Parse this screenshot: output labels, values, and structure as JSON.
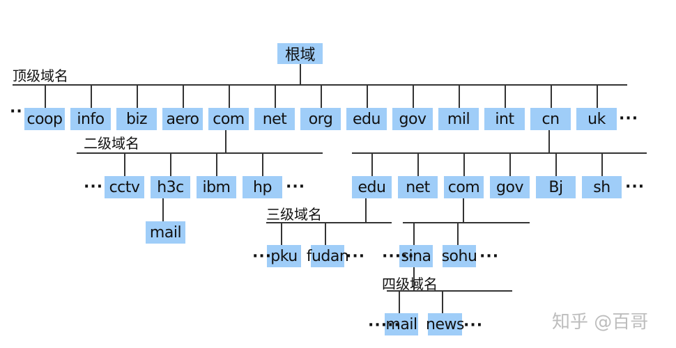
{
  "root": {
    "label": "根域"
  },
  "levels": {
    "top": "顶级域名",
    "second": "二级域名",
    "third": "三级域名",
    "fourth": "四级域名"
  },
  "top_level": [
    "coop",
    "info",
    "biz",
    "aero",
    "com",
    "net",
    "org",
    "edu",
    "gov",
    "mil",
    "int",
    "cn",
    "uk"
  ],
  "com_children": [
    "cctv",
    "h3c",
    "ibm",
    "hp"
  ],
  "h3c_children": [
    "mail"
  ],
  "cn_children": [
    "edu",
    "net",
    "com",
    "gov",
    "Bj",
    "sh"
  ],
  "edu_cn_children": [
    "pku",
    "fudan"
  ],
  "com_cn_children": [
    "sina",
    "sohu"
  ],
  "sina_children": [
    "mail",
    "news"
  ],
  "ellipsis": "···",
  "ellipsis_short": "··",
  "ellipsis_long": "·····",
  "watermark": "知乎 @百哥",
  "colors": {
    "node_fill": "#9fcdf8",
    "line": "#333333"
  }
}
